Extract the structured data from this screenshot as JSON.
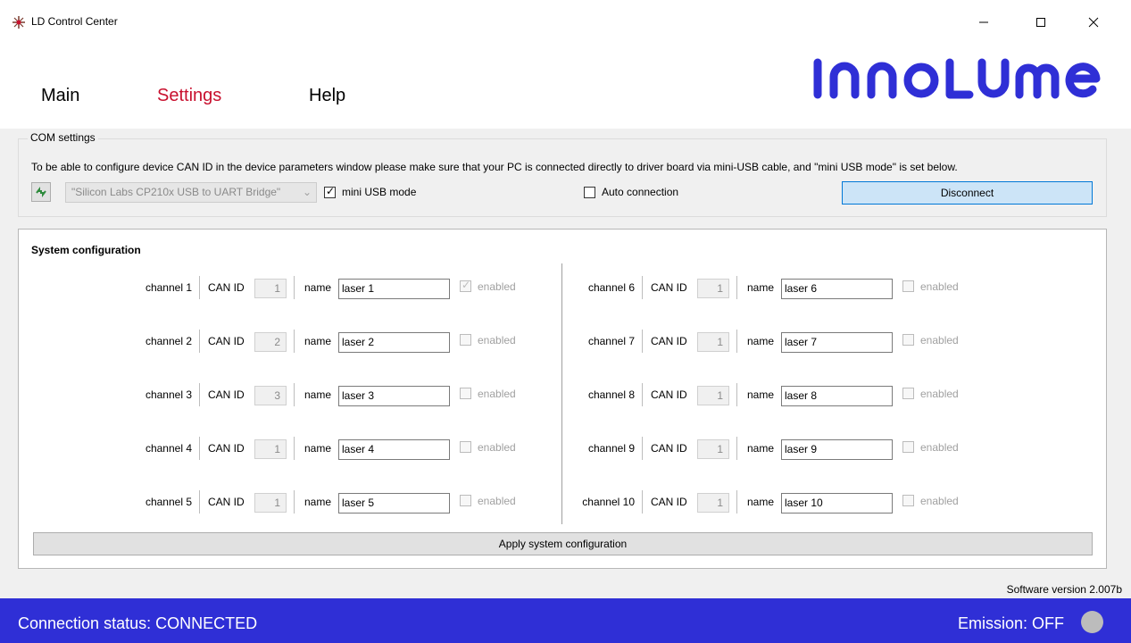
{
  "window": {
    "title": "LD Control Center"
  },
  "nav": {
    "main": "Main",
    "settings": "Settings",
    "help": "Help"
  },
  "logo": {
    "text": "INNOLUME",
    "color": "#2f2fd6"
  },
  "com": {
    "title": "COM settings",
    "info": "To be able to configure device CAN ID in the device parameters window please make sure that your PC is connected directly to driver board via mini-USB cable, and \"mini USB mode\" is set below.",
    "port": "\"Silicon Labs CP210x USB to UART Bridge\"",
    "mini_usb_label": "mini USB mode",
    "mini_usb_checked": true,
    "auto_label": "Auto connection",
    "auto_checked": false,
    "disconnect_label": "Disconnect"
  },
  "system": {
    "title": "System configuration",
    "canid_label": "CAN ID",
    "name_label": "name",
    "enabled_label": "enabled",
    "channels": [
      {
        "label": "channel 1",
        "can_id": "1",
        "name": "laser 1",
        "enabled": true
      },
      {
        "label": "channel 2",
        "can_id": "2",
        "name": "laser 2",
        "enabled": false
      },
      {
        "label": "channel 3",
        "can_id": "3",
        "name": "laser 3",
        "enabled": false
      },
      {
        "label": "channel 4",
        "can_id": "1",
        "name": "laser 4",
        "enabled": false
      },
      {
        "label": "channel 5",
        "can_id": "1",
        "name": "laser 5",
        "enabled": false
      },
      {
        "label": "channel 6",
        "can_id": "1",
        "name": "laser 6",
        "enabled": false
      },
      {
        "label": "channel 7",
        "can_id": "1",
        "name": "laser 7",
        "enabled": false
      },
      {
        "label": "channel 8",
        "can_id": "1",
        "name": "laser 8",
        "enabled": false
      },
      {
        "label": "channel 9",
        "can_id": "1",
        "name": "laser 9",
        "enabled": false
      },
      {
        "label": "channel 10",
        "can_id": "1",
        "name": "laser 10",
        "enabled": false
      }
    ],
    "apply_label": "Apply system configuration"
  },
  "version": "Software version 2.007b",
  "status": {
    "connection": "Connection status: CONNECTED",
    "emission": "Emission: OFF",
    "bar_color": "#2f2fd6",
    "led_color": "#bcbcbc"
  },
  "colors": {
    "accent_nav": "#c8102e"
  }
}
